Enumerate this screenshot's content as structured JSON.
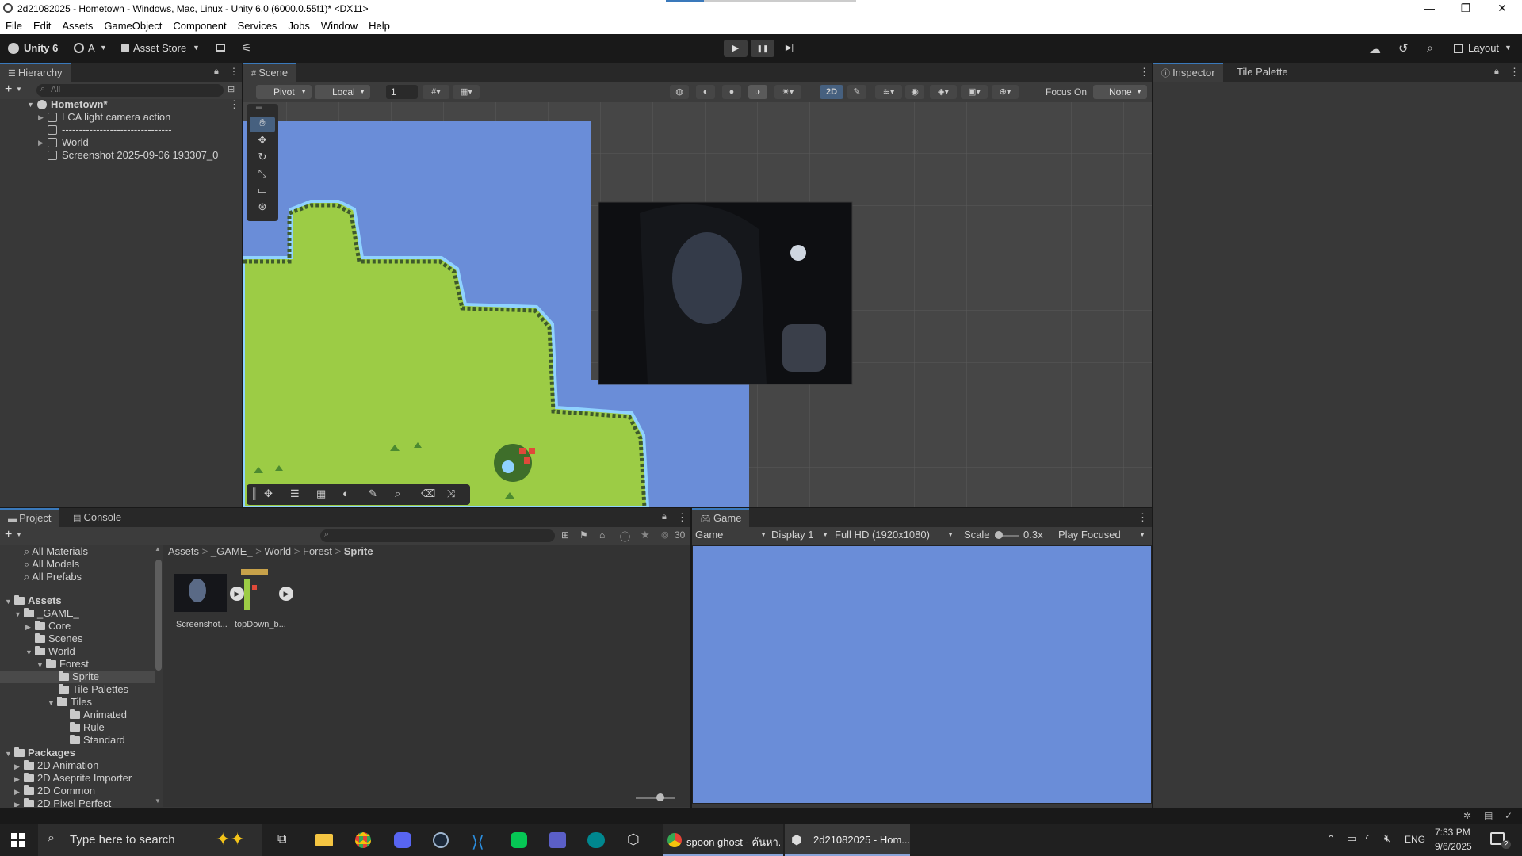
{
  "window": {
    "title": "2d21082025 - Hometown - Windows, Mac, Linux - Unity 6.0 (6000.0.55f1)* <DX11>",
    "minimize": "—",
    "maximize": "❐",
    "close": "✕"
  },
  "menu": [
    "File",
    "Edit",
    "Assets",
    "GameObject",
    "Component",
    "Services",
    "Jobs",
    "Window",
    "Help"
  ],
  "toolbar": {
    "unity_label": "Unity 6",
    "account_label": "A",
    "asset_store_label": "Asset Store",
    "layout_label": "Layout",
    "play_icon": "▶",
    "pause_icon": "❚❚",
    "step_icon": "▶|"
  },
  "hierarchy": {
    "tab": "Hierarchy",
    "search_placeholder": "All",
    "scene_name": "Hometown*",
    "items": [
      "LCA light camera action",
      "--------------------------------",
      "World",
      "Screenshot 2025-09-06 193307_0"
    ]
  },
  "scene": {
    "tab": "Scene",
    "pivot": "Pivot",
    "local": "Local",
    "grid_value": "1",
    "mode_2d": "2D",
    "focus_on": "Focus On",
    "focus_value": "None"
  },
  "inspector": {
    "tabs": [
      "Inspector",
      "Tile Palette"
    ]
  },
  "project": {
    "tabs": [
      "Project",
      "Console"
    ],
    "favorites": [
      "All Materials",
      "All Models",
      "All Prefabs"
    ],
    "assets_label": "Assets",
    "tree": [
      {
        "label": "_GAME_",
        "depth": 1,
        "open": true
      },
      {
        "label": "Core",
        "depth": 2
      },
      {
        "label": "Scenes",
        "depth": 2
      },
      {
        "label": "World",
        "depth": 2,
        "open": true
      },
      {
        "label": "Forest",
        "depth": 3,
        "open": true
      },
      {
        "label": "Sprite",
        "depth": 4,
        "selected": true
      },
      {
        "label": "Tile Palettes",
        "depth": 4
      },
      {
        "label": "Tiles",
        "depth": 4,
        "open": true
      },
      {
        "label": "Animated",
        "depth": 5
      },
      {
        "label": "Rule",
        "depth": 5
      },
      {
        "label": "Standard",
        "depth": 5
      }
    ],
    "packages_label": "Packages",
    "packages": [
      "2D Animation",
      "2D Aseprite Importer",
      "2D Common",
      "2D Pixel Perfect"
    ],
    "breadcrumb": [
      "Assets",
      "_GAME_",
      "World",
      "Forest",
      "Sprite"
    ],
    "hidden_count": "30",
    "files": [
      "Screenshot...",
      "topDown_b..."
    ]
  },
  "game": {
    "tab": "Game",
    "mode": "Game",
    "display": "Display 1",
    "resolution": "Full HD (1920x1080)",
    "scale_label": "Scale",
    "scale_value": "0.3x",
    "play_focused": "Play Focused"
  },
  "taskbar": {
    "search_placeholder": "Type here to search",
    "chrome_window": "spoon ghost - ค้นหา...",
    "unity_window": "2d21082025 - Hom...",
    "language": "ENG",
    "time": "7:33 PM",
    "date": "9/6/2025",
    "notifications": "2"
  },
  "colors": {
    "accent": "#3a79bb",
    "sky": "#6a8dd8",
    "grass": "#9ccc45",
    "grass_edge": "#3e5a2c",
    "water_edge": "#8fd2ff"
  }
}
